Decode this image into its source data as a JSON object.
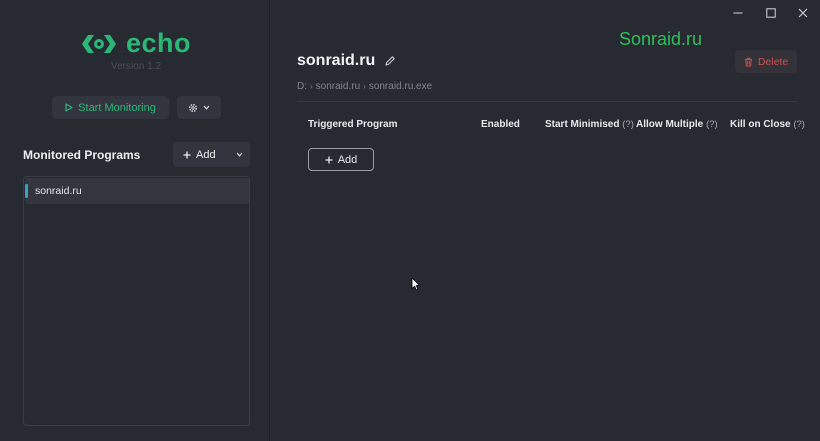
{
  "app": {
    "name": "echo",
    "version": "Version 1.2"
  },
  "sidebar": {
    "start_label": "Start Monitoring",
    "monitored_title": "Monitored Programs",
    "add_label": "Add",
    "items": [
      {
        "label": "sonraid.ru"
      }
    ]
  },
  "main": {
    "title": "sonraid.ru",
    "path": [
      "D:",
      "sonraid.ru",
      "sonraid.ru.exe"
    ],
    "watermark": "Sonraid.ru",
    "delete_label": "Delete",
    "columns": [
      {
        "label": "Triggered Program",
        "hint": ""
      },
      {
        "label": "Enabled",
        "hint": ""
      },
      {
        "label": "Start Minimised",
        "hint": "(?)"
      },
      {
        "label": "Allow Multiple",
        "hint": "(?)"
      },
      {
        "label": "Kill on Close",
        "hint": "(?)"
      }
    ],
    "add_label": "Add"
  },
  "colors": {
    "accent": "#2bb876",
    "danger": "#c85050",
    "selection": "#30a6b6",
    "background": "#282a31"
  },
  "icons": [
    "echo-logo-icon",
    "play-icon",
    "gear-icon",
    "chevron-down-icon",
    "plus-icon",
    "pencil-icon",
    "trash-icon",
    "minimize-icon",
    "maximize-icon",
    "close-icon"
  ]
}
